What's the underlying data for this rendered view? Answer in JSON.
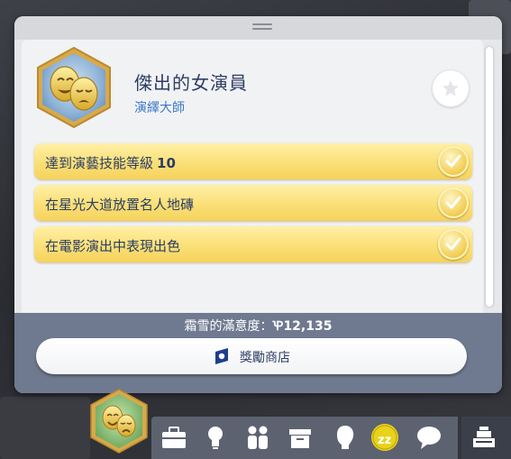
{
  "aspiration": {
    "title": "傑出的女演員",
    "category": "演繹大師",
    "icon": "comedy-tragedy-masks-icon"
  },
  "tasks": [
    {
      "label": "達到演藝技能等級",
      "value": "10",
      "completed": true
    },
    {
      "label": "在星光大道放置名人地磚",
      "value": "",
      "completed": true
    },
    {
      "label": "在電影演出中表現出色",
      "value": "",
      "completed": true
    }
  ],
  "satisfaction": {
    "label": "霜雪的滿意度：",
    "value": "Ꝕ12,135"
  },
  "reward_store": {
    "label": "獎勵商店"
  },
  "toolbar": {
    "icons": [
      "aspiration-icon",
      "career-icon",
      "skills-icon",
      "relationships-icon",
      "inventory-icon",
      "sim-info-icon",
      "needs-icon",
      "chat-icon",
      "shopping-icon"
    ]
  },
  "colors": {
    "task_gold": "#f5d25c",
    "title_blue": "#2d3e64",
    "category_blue": "#3a78c8",
    "footer": "#6f7a90"
  }
}
